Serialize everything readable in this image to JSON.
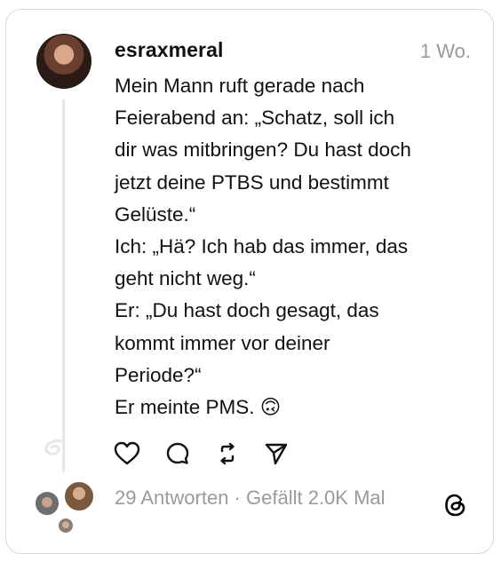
{
  "post": {
    "username": "esraxmeral",
    "time": "1 Wo.",
    "lines": [
      "Mein Mann ruft gerade nach",
      "Feierabend an: „Schatz, soll ich",
      "dir was mitbringen? Du hast doch",
      "jetzt deine PTBS und bestimmt",
      "Gelüste.“",
      "Ich: „Hä? Ich hab das immer, das",
      "geht nicht weg.“",
      "Er: „Du hast doch gesagt, das",
      "kommt immer vor deiner",
      "Periode?“",
      "Er meinte PMS. 🙃"
    ]
  },
  "actions": {
    "like_icon": "heart-icon",
    "reply_icon": "comment-icon",
    "repost_icon": "repost-icon",
    "share_icon": "send-icon"
  },
  "footer": {
    "replies": "29 Antworten",
    "separator": " · ",
    "likes": "Gefällt 2.0K Mal"
  },
  "colors": {
    "text": "#111111",
    "muted": "#9a9a9a",
    "border": "#d9d9d9",
    "thread_line": "#e6e6e6"
  }
}
